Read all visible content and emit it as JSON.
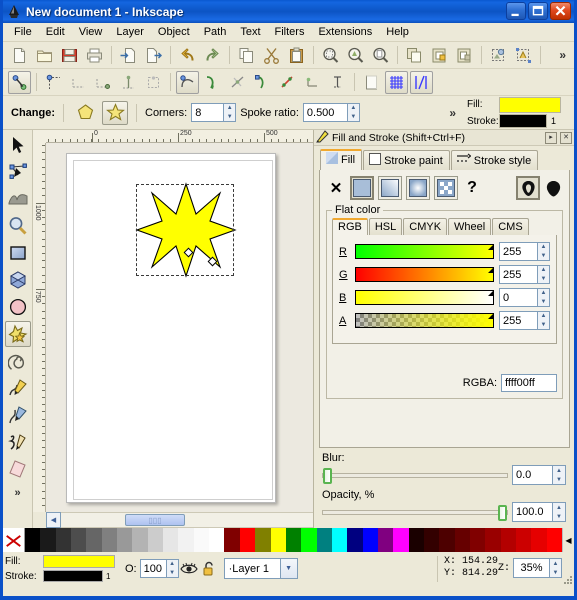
{
  "window": {
    "title": "New document 1 - Inkscape",
    "app_icon": "inkscape-logo-icon",
    "minimize_label": "_",
    "maximize_label": "□",
    "close_label": "✕"
  },
  "menubar": {
    "items": [
      {
        "label": "File",
        "accel": "F"
      },
      {
        "label": "Edit",
        "accel": "E"
      },
      {
        "label": "View",
        "accel": "V"
      },
      {
        "label": "Layer",
        "accel": "L"
      },
      {
        "label": "Object",
        "accel": "O"
      },
      {
        "label": "Path",
        "accel": "P"
      },
      {
        "label": "Text",
        "accel": "T"
      },
      {
        "label": "Filters",
        "accel": "s"
      },
      {
        "label": "Extensions",
        "accel": "n"
      },
      {
        "label": "Help",
        "accel": "H"
      }
    ]
  },
  "command_toolbar": {
    "overflow_label": "»",
    "buttons": [
      {
        "name": "new-document-icon",
        "title": "New"
      },
      {
        "name": "open-document-icon",
        "title": "Open"
      },
      {
        "name": "save-document-icon",
        "title": "Save"
      },
      {
        "name": "print-document-icon",
        "title": "Print"
      },
      {
        "name": "import-icon",
        "title": "Import"
      },
      {
        "name": "export-icon",
        "title": "Export"
      },
      {
        "name": "undo-icon",
        "title": "Undo"
      },
      {
        "name": "redo-icon",
        "title": "Redo"
      },
      {
        "name": "copy-icon",
        "title": "Copy"
      },
      {
        "name": "cut-icon",
        "title": "Cut"
      },
      {
        "name": "paste-icon",
        "title": "Paste"
      },
      {
        "name": "zoom-selection-icon",
        "title": "Zoom selection"
      },
      {
        "name": "zoom-drawing-icon",
        "title": "Zoom drawing"
      },
      {
        "name": "zoom-page-icon",
        "title": "Zoom page"
      },
      {
        "name": "duplicate-icon",
        "title": "Duplicate"
      },
      {
        "name": "group-icon",
        "title": "Group"
      },
      {
        "name": "ungroup-icon",
        "title": "Ungroup"
      },
      {
        "name": "object-properties-icon",
        "title": "Object properties"
      },
      {
        "name": "xml-editor-icon",
        "title": "XML editor"
      }
    ]
  },
  "snap_toolbar": {
    "buttons": [
      {
        "name": "enable-snapping-icon",
        "active": true
      },
      {
        "name": "snap-bounding-box-icon",
        "active": false
      },
      {
        "name": "snap-bbox-edges-icon",
        "active": false
      },
      {
        "name": "snap-bbox-corners-icon",
        "active": false
      },
      {
        "name": "snap-bbox-edge-midpoints-icon",
        "active": false
      },
      {
        "name": "snap-bbox-centers-icon",
        "active": false
      },
      {
        "name": "snap-nodes-paths-icon",
        "active": true
      },
      {
        "name": "snap-paths-icon",
        "active": false
      },
      {
        "name": "snap-path-intersections-icon",
        "active": false
      },
      {
        "name": "snap-cusp-nodes-icon",
        "active": false
      },
      {
        "name": "snap-smooth-nodes-icon",
        "active": false
      },
      {
        "name": "snap-line-midpoints-icon",
        "active": false
      },
      {
        "name": "snap-object-centers-icon",
        "active": false
      },
      {
        "name": "snap-rotation-centers-icon",
        "active": false
      },
      {
        "name": "snap-page-border-icon",
        "active": false
      },
      {
        "name": "snap-grid-icon",
        "active": true
      },
      {
        "name": "snap-guides-icon",
        "active": true
      }
    ]
  },
  "tool_options": {
    "change_label": "Change:",
    "polygon_button": "polygon-shape-icon",
    "star_button": "star-shape-icon",
    "star_active": true,
    "corners_label": "Corners:",
    "corners_value": "8",
    "spoke_ratio_label": "Spoke ratio:",
    "spoke_ratio_value": "0.500",
    "overflow_label": "»",
    "fill_label": "Fill:",
    "stroke_label": "Stroke:",
    "fill_color": "#ffff00",
    "stroke_color": "#000000",
    "stroke_width": "1"
  },
  "toolbox": {
    "overflow_label": "»",
    "tools": [
      {
        "name": "selector-tool-icon",
        "label": "Selector",
        "selected": false
      },
      {
        "name": "node-editor-tool-icon",
        "label": "Edit paths by nodes",
        "selected": false
      },
      {
        "name": "tweak-tool-icon",
        "label": "Tweak objects",
        "selected": false
      },
      {
        "name": "zoom-tool-icon",
        "label": "Zoom",
        "selected": false
      },
      {
        "name": "rectangle-tool-icon",
        "label": "Rectangles and squares",
        "selected": false
      },
      {
        "name": "box3d-tool-icon",
        "label": "3D boxes",
        "selected": false
      },
      {
        "name": "ellipse-tool-icon",
        "label": "Circles, ellipses and arcs",
        "selected": false
      },
      {
        "name": "star-tool-icon",
        "label": "Stars and polygons",
        "selected": true
      },
      {
        "name": "spiral-tool-icon",
        "label": "Spirals",
        "selected": false
      },
      {
        "name": "pencil-tool-icon",
        "label": "Freehand lines",
        "selected": false
      },
      {
        "name": "bezier-tool-icon",
        "label": "Bezier curves and straight lines",
        "selected": false
      },
      {
        "name": "calligraphy-tool-icon",
        "label": "Calligraphic lines",
        "selected": false
      },
      {
        "name": "eraser-tool-icon",
        "label": "Erase",
        "selected": false
      }
    ]
  },
  "canvas": {
    "ruler_h_labels": [
      "0",
      "250",
      "500"
    ],
    "ruler_v_labels": [
      "1000",
      "750"
    ],
    "page_background": "#ffffff",
    "star": {
      "name": "star-object",
      "fill": "#ffff00",
      "stroke": "#000000",
      "points": 8,
      "spoke_ratio": 0.5,
      "selected": true
    },
    "zoom_icon": "zoom-1-to-1-icon",
    "palette_icon": "palette-indicator-icon",
    "hscroll_left": "◀",
    "hscroll_right": "▶",
    "vscroll_up": "▲",
    "vscroll_down": "▼"
  },
  "dialog": {
    "title": "Fill and Stroke (Shift+Ctrl+F)",
    "title_icon": "fill-stroke-icon",
    "float_button": "▸",
    "close_button": "✕",
    "tabs": [
      {
        "label": "Fill",
        "icon": "fill-swatch-icon",
        "active": true
      },
      {
        "label": "Stroke paint",
        "icon": "stroke-paint-icon",
        "active": false
      },
      {
        "label": "Stroke style",
        "icon": "stroke-style-icon",
        "active": false
      }
    ],
    "paint_types": [
      {
        "name": "no-paint-button",
        "glyph": "✕",
        "active": false
      },
      {
        "name": "flat-color-button",
        "glyph": "flat",
        "active": true
      },
      {
        "name": "linear-gradient-button",
        "glyph": "linear",
        "active": false
      },
      {
        "name": "radial-gradient-button",
        "glyph": "radial",
        "active": false
      },
      {
        "name": "pattern-button",
        "glyph": "pattern",
        "active": false
      },
      {
        "name": "unknown-paint-button",
        "glyph": "?",
        "active": false
      }
    ],
    "fill_rule_buttons": [
      {
        "name": "even-odd-fill-rule-button",
        "active": true
      },
      {
        "name": "nonzero-fill-rule-button",
        "active": false
      }
    ],
    "flat_color_legend": "Flat color",
    "color_tabs": [
      {
        "label": "RGB",
        "active": true
      },
      {
        "label": "HSL",
        "active": false
      },
      {
        "label": "CMYK",
        "active": false
      },
      {
        "label": "Wheel",
        "active": false
      },
      {
        "label": "CMS",
        "active": false
      }
    ],
    "channels": [
      {
        "key": "R",
        "value": "255",
        "track": "r"
      },
      {
        "key": "G",
        "value": "255",
        "track": "g"
      },
      {
        "key": "B",
        "value": "0",
        "track": "b"
      },
      {
        "key": "A",
        "value": "255",
        "track": "a"
      }
    ],
    "rgba_label": "RGBA:",
    "rgba_value": "ffff00ff",
    "blur_label": "Blur:",
    "blur_value": "0.0",
    "blur_fraction": 0,
    "opacity_label": "Opacity, %",
    "opacity_value": "100.0",
    "opacity_fraction": 1
  },
  "palette": {
    "none_swatch": "no-color-swatch",
    "colors": [
      "#000000",
      "#1a1a1a",
      "#333333",
      "#4d4d4d",
      "#666666",
      "#808080",
      "#999999",
      "#b3b3b3",
      "#cccccc",
      "#e6e6e6",
      "#f2f2f2",
      "#fafafa",
      "#ffffff",
      "#800000",
      "#ff0000",
      "#808000",
      "#ffff00",
      "#008000",
      "#00ff00",
      "#008080",
      "#00ffff",
      "#000080",
      "#0000ff",
      "#800080",
      "#ff00ff",
      "#1a0000",
      "#330000",
      "#4d0000",
      "#660000",
      "#800000",
      "#990000",
      "#b30000",
      "#cc0000",
      "#e60000",
      "#ff0000"
    ],
    "scroll_arrow": "◀"
  },
  "statusbar": {
    "fill_label": "Fill:",
    "stroke_label": "Stroke:",
    "fill_color": "#ffff00",
    "stroke_color": "#000000",
    "stroke_width": "1",
    "opacity_label": "O:",
    "opacity_value": "100",
    "eye_icon": "layer-visible-icon",
    "lock_icon": "layer-unlocked-icon",
    "layer_name": "·Layer 1",
    "coord_x_label": "X:",
    "coord_x_value": "154.29",
    "coord_y_label": "Y:",
    "coord_y_value": "814.29",
    "zoom_label": "Z:",
    "zoom_value": "35%"
  }
}
